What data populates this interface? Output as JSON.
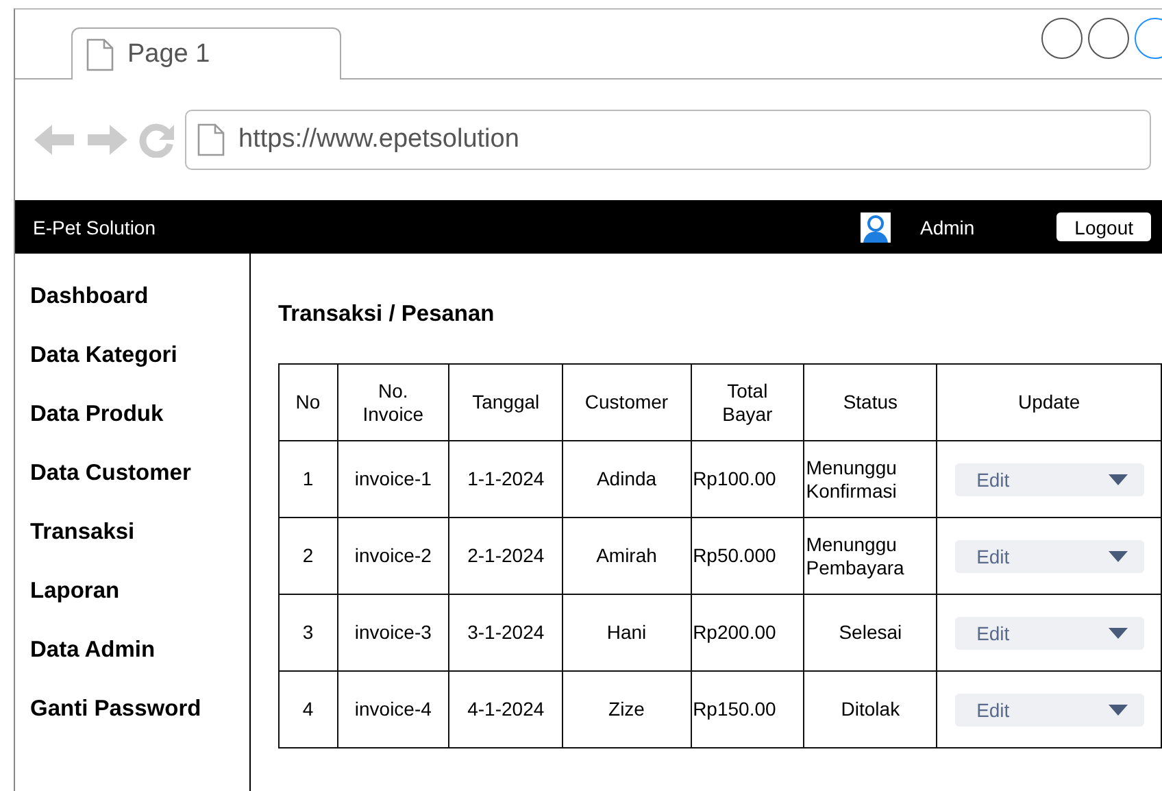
{
  "browser": {
    "tab": {
      "title": "Page 1"
    },
    "url": "https://www.epetsolution"
  },
  "header": {
    "brand": "E-Pet Solution",
    "user": "Admin",
    "logout": "Logout"
  },
  "sidebar": {
    "items": [
      {
        "label": "Dashboard"
      },
      {
        "label": "Data Kategori"
      },
      {
        "label": "Data Produk"
      },
      {
        "label": "Data Customer"
      },
      {
        "label": "Transaksi"
      },
      {
        "label": "Laporan"
      },
      {
        "label": "Data Admin"
      },
      {
        "label": "Ganti Password"
      }
    ]
  },
  "content": {
    "title": "Transaksi / Pesanan",
    "table": {
      "columns": [
        [
          "No"
        ],
        [
          "No.",
          "Invoice"
        ],
        [
          "Tanggal"
        ],
        [
          "Customer"
        ],
        [
          "Total",
          "Bayar"
        ],
        [
          "Status"
        ],
        [
          "Update"
        ]
      ],
      "rows": [
        {
          "no": "1",
          "invoice": "invoice-1",
          "date": "1-1-2024",
          "customer": "Adinda",
          "total": "Rp100.00",
          "status": [
            "Menunggu",
            "Konfirmasi"
          ],
          "action": "Edit"
        },
        {
          "no": "2",
          "invoice": "invoice-2",
          "date": "2-1-2024",
          "customer": "Amirah",
          "total": "Rp50.000",
          "status": [
            "Menunggu",
            "Pembayara"
          ],
          "action": "Edit"
        },
        {
          "no": "3",
          "invoice": "invoice-3",
          "date": "3-1-2024",
          "customer": "Hani",
          "total": "Rp200.00",
          "status": [
            "Selesai"
          ],
          "action": "Edit"
        },
        {
          "no": "4",
          "invoice": "invoice-4",
          "date": "4-1-2024",
          "customer": "Zize",
          "total": "Rp150.00",
          "status": [
            "Ditolak"
          ],
          "action": "Edit"
        }
      ]
    }
  }
}
